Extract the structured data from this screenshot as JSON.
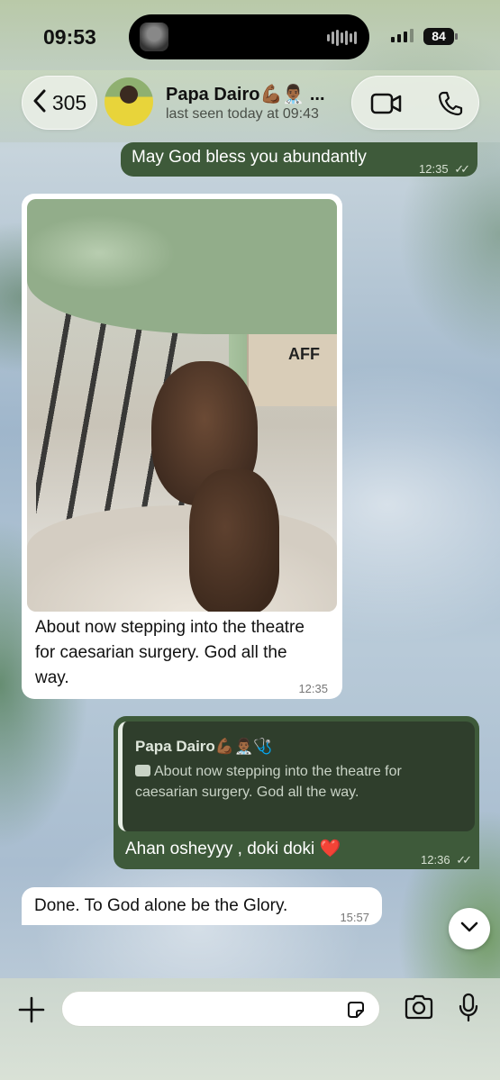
{
  "status_bar": {
    "time": "09:53",
    "battery": "84"
  },
  "header": {
    "back_count": "305",
    "contact_name": "Papa Dairo💪🏾👨🏾‍⚕️ ...",
    "last_seen": "last seen today at 09:43"
  },
  "messages": [
    {
      "direction": "outgoing",
      "text": "May God bless you abundantly",
      "time": "12:35",
      "ticks": "✓✓"
    },
    {
      "direction": "incoming",
      "has_photo": true,
      "photo_box_text": "AFF",
      "text": "About now stepping into the theatre for caesarian surgery. God all the way.",
      "time": "12:35"
    },
    {
      "direction": "outgoing",
      "quote_author": "Papa Dairo💪🏾👨🏾‍⚕️🩺",
      "quote_text": "About now stepping into the theatre for caesarian surgery. God all the way.",
      "text": "Ahan osheyyy , doki doki ❤️",
      "time": "12:36",
      "ticks": "✓✓"
    },
    {
      "direction": "incoming",
      "text": "Done. To God alone be the Glory.",
      "time": "15:57"
    }
  ],
  "input": {
    "placeholder": ""
  },
  "colors": {
    "outgoing_bubble": "#3e5a3a",
    "incoming_bubble": "#ffffff",
    "quote_background": "#2f3e2c"
  },
  "icons": {
    "back": "chevron-left-icon",
    "video": "video-camera-icon",
    "phone": "phone-icon",
    "scroll": "chevron-down-icon",
    "attach": "plus-icon",
    "sticker": "sticker-icon",
    "camera": "camera-icon",
    "mic": "microphone-icon"
  }
}
